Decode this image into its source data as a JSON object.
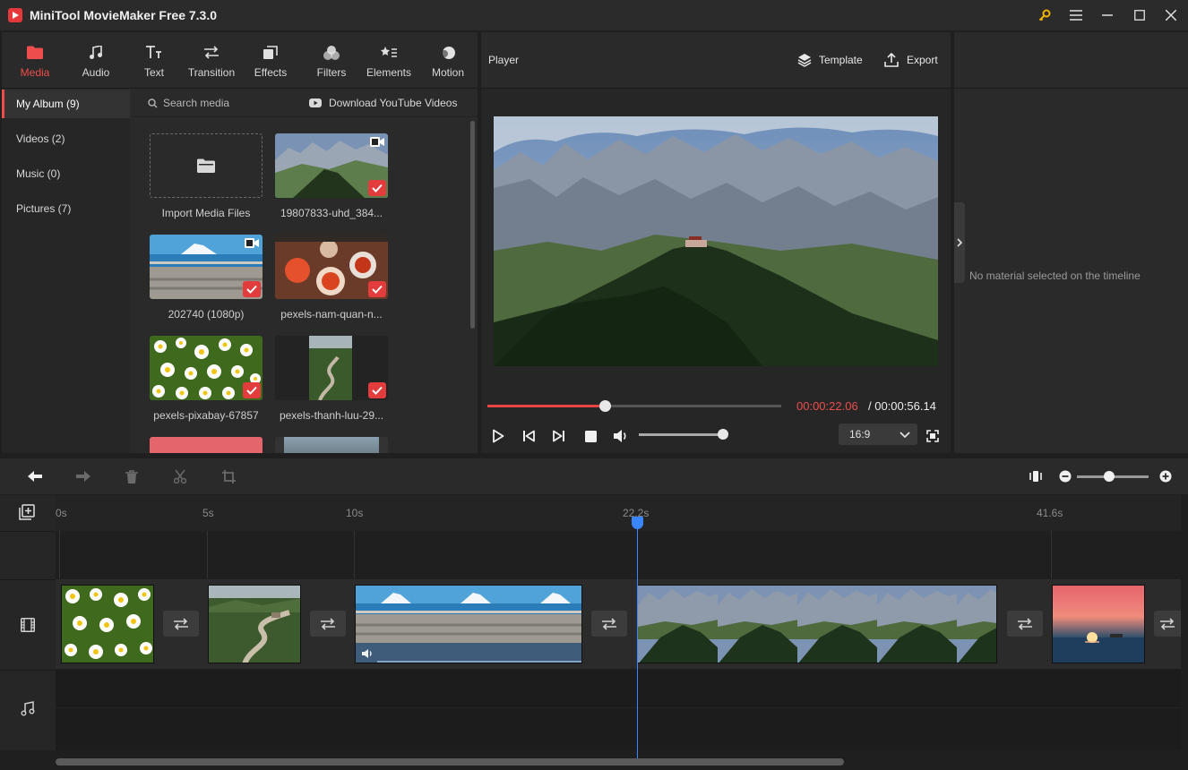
{
  "app": {
    "title": "MiniTool MovieMaker Free 7.3.0"
  },
  "toolbar": {
    "tabs": [
      {
        "label": "Media",
        "icon": "folder-icon",
        "active": true
      },
      {
        "label": "Audio",
        "icon": "music-note-icon"
      },
      {
        "label": "Text",
        "icon": "text-icon"
      },
      {
        "label": "Transition",
        "icon": "transition-icon"
      },
      {
        "label": "Effects",
        "icon": "effects-icon"
      },
      {
        "label": "Filters",
        "icon": "filters-icon"
      },
      {
        "label": "Elements",
        "icon": "elements-icon"
      },
      {
        "label": "Motion",
        "icon": "motion-icon"
      }
    ]
  },
  "albums": [
    {
      "label": "My Album (9)",
      "active": true
    },
    {
      "label": "Videos (2)"
    },
    {
      "label": "Music (0)"
    },
    {
      "label": "Pictures (7)"
    }
  ],
  "search": {
    "placeholder": "Search media"
  },
  "youtube": {
    "label": "Download YouTube Videos"
  },
  "media": [
    {
      "label": "Import Media Files",
      "type": "import"
    },
    {
      "label": "19807833-uhd_384...",
      "type": "video",
      "checked": true
    },
    {
      "label": "202740 (1080p)",
      "type": "video",
      "checked": true
    },
    {
      "label": "pexels-nam-quan-n...",
      "type": "picture",
      "checked": true
    },
    {
      "label": "pexels-pixabay-67857",
      "type": "picture",
      "checked": true
    },
    {
      "label": "pexels-thanh-luu-29...",
      "type": "picture",
      "checked": true
    }
  ],
  "player": {
    "title": "Player",
    "template_label": "Template",
    "export_label": "Export",
    "time_current": "00:00:22.06",
    "time_total": " / 00:00:56.14",
    "progress": 0.4,
    "volume": 1.0,
    "aspect_ratio": "16:9"
  },
  "properties": {
    "empty_text": "No material selected on the timeline"
  },
  "timeline": {
    "ticks": [
      "0s",
      "5s",
      "10s",
      "22.2s",
      "41.6s"
    ],
    "playhead": "22.2s"
  },
  "colors": {
    "accent": "#ee4d4d",
    "playhead": "#3a86ff"
  }
}
